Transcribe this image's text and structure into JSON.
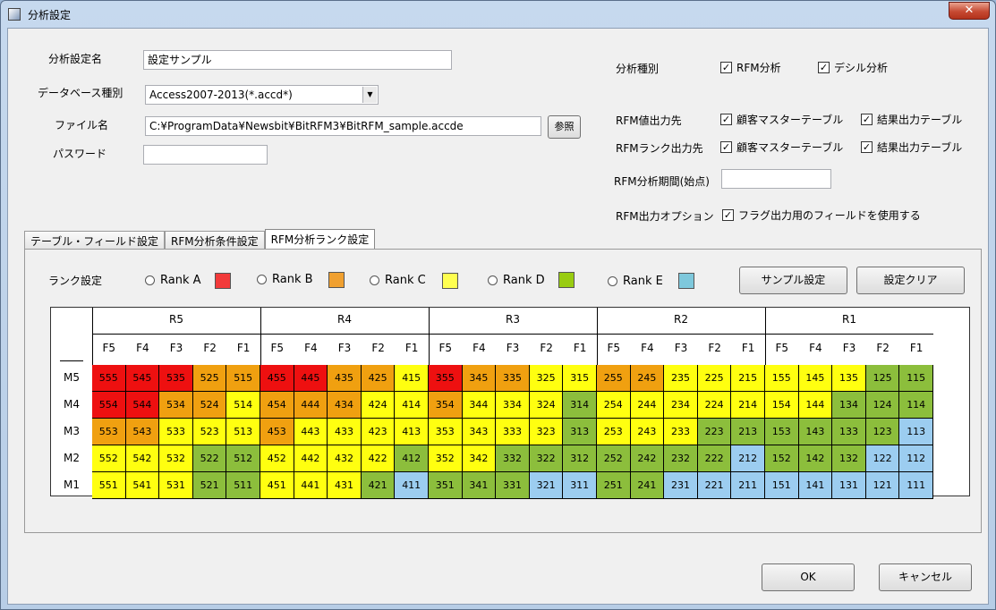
{
  "window": {
    "title": "分析設定",
    "close_label": "✕"
  },
  "form": {
    "name_label": "分析設定名",
    "name_value": "設定サンプル",
    "db_label": "データベース種別",
    "db_value": "Access2007-2013(*.accd*)",
    "file_label": "ファイル名",
    "file_value": "C:¥ProgramData¥Newsbit¥BitRFM3¥BitRFM_sample.accde",
    "browse_label": "参照",
    "password_label": "パスワード",
    "password_value": ""
  },
  "options": {
    "type_label": "分析種別",
    "rfm_analysis": "RFM分析",
    "decile_analysis": "デシル分析",
    "value_out_label": "RFM値出力先",
    "rank_out_label": "RFMランク出力先",
    "customer_master": "顧客マスターテーブル",
    "result_table": "結果出力テーブル",
    "period_label": "RFM分析期間(始点)",
    "period_value": "",
    "out_option_label": "RFM出力オプション",
    "flag_field": "フラグ出力用のフィールドを使用する",
    "checked_mark": "✓"
  },
  "tabs": [
    {
      "label": "テーブル・フィールド設定"
    },
    {
      "label": "RFM分析条件設定"
    },
    {
      "label": "RFM分析ランク設定"
    }
  ],
  "rank": {
    "label": "ランク設定",
    "ranks": [
      {
        "label": "Rank A",
        "color": "#f23a3a"
      },
      {
        "label": "Rank B",
        "color": "#f0a030"
      },
      {
        "label": "Rank C",
        "color": "#ffff50"
      },
      {
        "label": "Rank D",
        "color": "#99cc11"
      },
      {
        "label": "Rank E",
        "color": "#7ec8dc"
      }
    ],
    "sample_label": "サンプル設定",
    "clear_label": "設定クリア"
  },
  "colors": {
    "A": "#ee1010",
    "B": "#f0a010",
    "C": "#ffff10",
    "D": "#8cbe3c",
    "E": "#9ccdf0"
  },
  "grid": {
    "r_headers": [
      "R5",
      "R4",
      "R3",
      "R2",
      "R1"
    ],
    "f_headers": [
      "F5",
      "F4",
      "F3",
      "F2",
      "F1"
    ],
    "m_headers": [
      "M5",
      "M4",
      "M3",
      "M2",
      "M1"
    ],
    "ranks": [
      [
        "AAABB",
        "AABBC",
        "ABBCC",
        "BBCCC",
        "CCCDD"
      ],
      [
        "AABBC",
        "BBBCC",
        "BCCCD",
        "CCCCC",
        "CCDDD"
      ],
      [
        "BBCCC",
        "BCCCC",
        "CCCCD",
        "CCCDD",
        "DDDDE"
      ],
      [
        "CCCDD",
        "CCCCD",
        "CCDDD",
        "DDDDE",
        "DDDEE"
      ],
      [
        "CCCDD",
        "CCCDE",
        "DDDEE",
        "DDEEE",
        "EEEEE"
      ]
    ]
  },
  "footer": {
    "ok_label": "OK",
    "cancel_label": "キャンセル"
  }
}
